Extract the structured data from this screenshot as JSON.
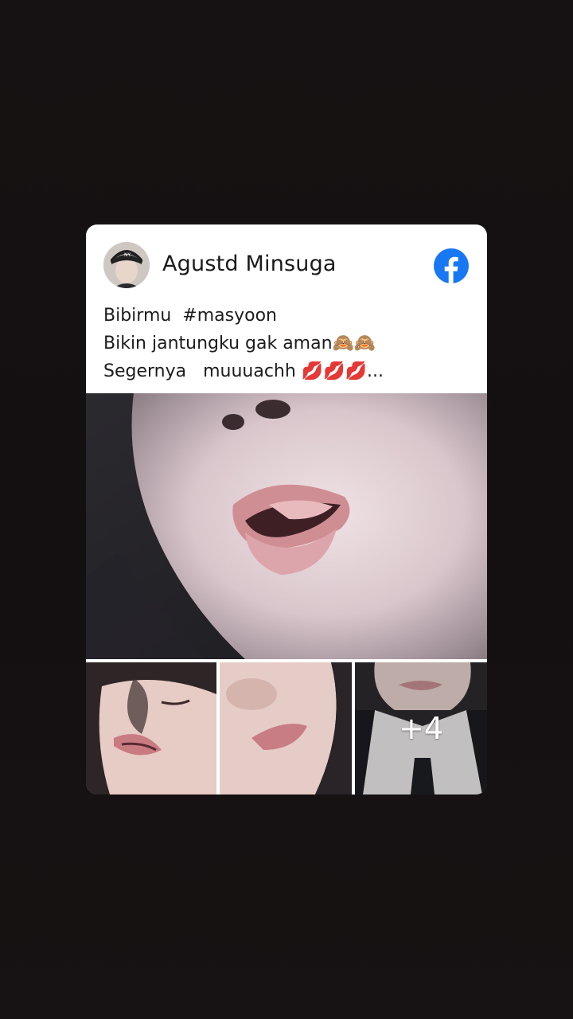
{
  "post": {
    "author_name": "Agustd Minsuga",
    "platform_icon": "facebook-icon",
    "caption_lines": [
      "Bibirmu  #masyoon",
      "Bikin jantungku gak aman🙈🙈",
      "Segernya   muuuachh 💋💋💋..."
    ],
    "more_photos_label": "+4"
  },
  "colors": {
    "page_background": "#151112",
    "card_background": "#ffffff",
    "facebook_blue": "#1877f2",
    "text": "#1a1a1a"
  }
}
